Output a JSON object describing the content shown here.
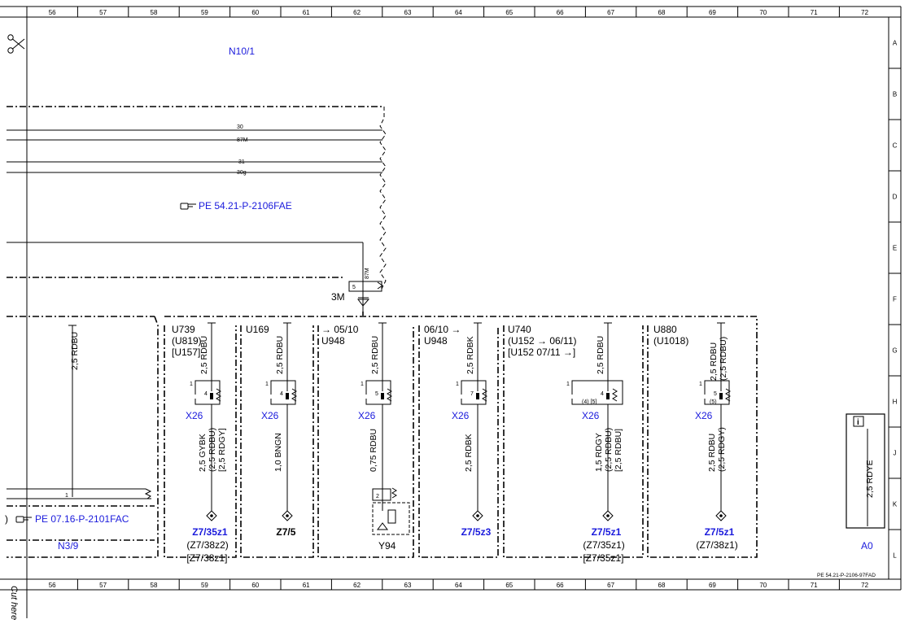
{
  "columns": [
    "56",
    "57",
    "58",
    "59",
    "60",
    "61",
    "62",
    "63",
    "64",
    "65",
    "66",
    "67",
    "68",
    "69",
    "70",
    "71",
    "72"
  ],
  "rows": [
    "A",
    "B",
    "C",
    "D",
    "E",
    "F",
    "G",
    "H",
    "J",
    "K",
    "L"
  ],
  "title_component": "N10/1",
  "cut_here": "Cut here",
  "bus": {
    "wires": [
      "30",
      "87M",
      "31",
      "30g"
    ],
    "ref": "PE 54.21-P-2106FAE",
    "pin87M": "87M",
    "pin5": "5",
    "ground": "3M"
  },
  "left": {
    "wire": "2,5 RDBU",
    "pin": "1",
    "ref": "PE 07.16-P-2101FAC",
    "component": "N3/9"
  },
  "modules": [
    {
      "code": [
        "U739",
        "(U819)",
        "[U157]"
      ],
      "wire_top": "2,5 RDBU",
      "pin_left": "1",
      "pin": "4",
      "connector": "X26",
      "wire_bottom": [
        "2,5 GYBK",
        "(2,5 RDBU)",
        "[2,5 RDGY]"
      ],
      "dest": [
        "Z7/35z1",
        "(Z7/38z2)",
        "[Z7/38z1]"
      ]
    },
    {
      "code": [
        "U169"
      ],
      "wire_top": "2,5 RDBU",
      "pin_left": "1",
      "pin": "4",
      "connector": "X26",
      "wire_bottom": [
        "1,0 BNGN"
      ],
      "dest": [
        "Z7/5"
      ]
    },
    {
      "code": [
        "→ 05/10",
        "U948"
      ],
      "wire_top": "2,5 RDBU",
      "pin_left": "1",
      "pin": "5",
      "connector": "X26",
      "wire_bottom": [
        "0,75 RDBU"
      ],
      "dest": [
        "Y94"
      ],
      "dest_pin": "2"
    },
    {
      "code": [
        "06/10 →",
        "U948"
      ],
      "wire_top": "2,5 RDBK",
      "pin_left": "1",
      "pin": "7",
      "connector": "X26",
      "wire_bottom": [
        "2,5 RDBK"
      ],
      "dest": [
        "Z7/5z3"
      ]
    },
    {
      "code": [
        "U740",
        "(U152 → 06/11)",
        "[U152  07/11 →]"
      ],
      "wire_top": "2,5 RDBU",
      "pin_left": "1",
      "pin": "4",
      "pin_alt": "(4) [5]",
      "connector": "X26",
      "wire_bottom": [
        "1,5 RDGY",
        "(2,5 RDBU)",
        "[2,5 RDBU]"
      ],
      "dest": [
        "Z7/5z1",
        "(Z7/35z1)",
        "[Z7/35z1]"
      ]
    },
    {
      "code": [
        "U880",
        "(U1018)"
      ],
      "wire_top": [
        "2,5 RDBU",
        "(2,5 RDBU)"
      ],
      "pin_left": "1",
      "pin": "5",
      "pin_alt": "(5)",
      "connector": "X26",
      "wire_bottom": [
        "2,5 RDBU",
        "(2,5 RDGY)"
      ],
      "dest": [
        "Z7/5z1",
        "(Z7/38z1)"
      ]
    }
  ],
  "legend": {
    "icon": "info-icon",
    "wire": "2,5 RDYE",
    "label": "A0"
  },
  "doc_id": "PE 54.21-P-2106-97FAD",
  "colors": {
    "link": "#1a1adc",
    "line": "#000000"
  }
}
